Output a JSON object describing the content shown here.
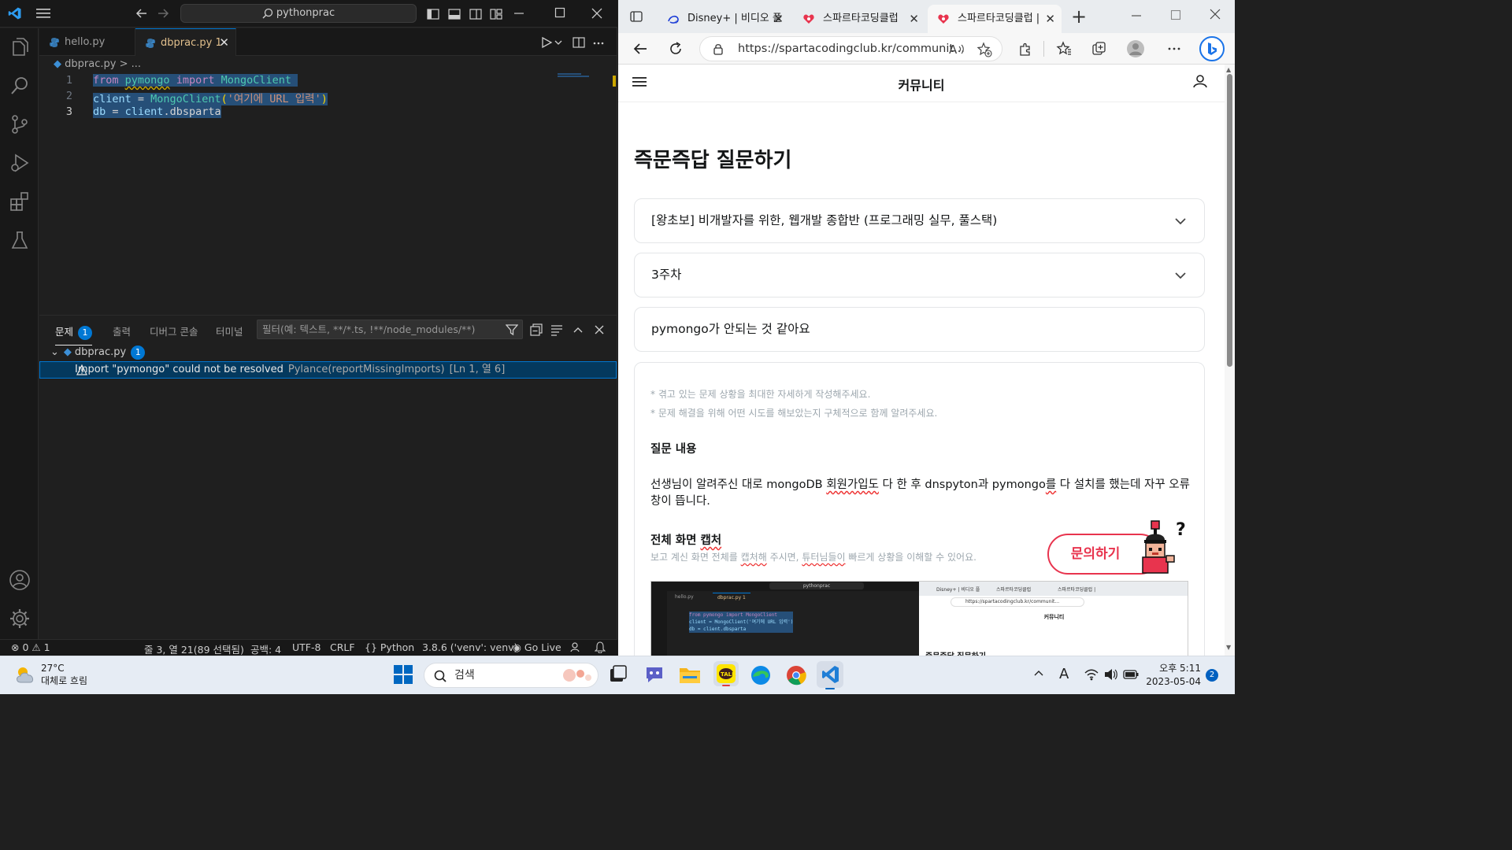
{
  "vscode": {
    "command_center": "pythonprac",
    "tabs": [
      {
        "label": "hello.py"
      },
      {
        "label": "dbprac.py",
        "badge": "1"
      }
    ],
    "breadcrumb": "dbprac.py > ...",
    "code": {
      "line_numbers": [
        "1",
        "2",
        "3"
      ],
      "line1": {
        "kw_from": "from",
        "module": "pymongo",
        "kw_import": "import",
        "class": "MongoClient"
      },
      "line2": {
        "var": "client",
        "eq": " = ",
        "func": "MongoClient",
        "open": "(",
        "string": "'여기에 URL 입력'",
        "close": ")"
      },
      "line3": {
        "var": "db",
        "eq": " = ",
        "obj": "client",
        "attr": ".dbsparta"
      }
    },
    "panel": {
      "tabs": [
        {
          "label": "문제",
          "badge": "1"
        },
        {
          "label": "출력"
        },
        {
          "label": "디버그 콘솔"
        },
        {
          "label": "터미널"
        }
      ],
      "filter_placeholder": "필터(예: 텍스트, **/*.ts, !**/node_modules/**)",
      "file": {
        "name": "dbprac.py",
        "badge": "1"
      },
      "problem": {
        "message": "Import \"pymongo\" could not be resolved",
        "source": "Pylance(reportMissingImports)",
        "location": "[Ln 1, 열 6]"
      }
    },
    "status": {
      "errors": "0",
      "warnings": "1",
      "cursor": "줄 3, 열 21(89 선택됨)",
      "indent": "공백: 4",
      "encoding": "UTF-8",
      "eol": "CRLF",
      "language": "Python",
      "interpreter": "3.8.6 ('venv': venv)",
      "golive": "Go Live"
    }
  },
  "browser": {
    "tabs": [
      {
        "label": "Disney+ | 비디오 플"
      },
      {
        "label": "스파르타코딩클럽"
      },
      {
        "label": "스파르타코딩클럽 |"
      }
    ],
    "url": "https://spartacodingclub.kr/communit...",
    "page": {
      "header_title": "커뮤니티",
      "heading": "즉문즉답 질문하기",
      "course_select": "[왕초보] 비개발자를 위한, 웹개발 종합반 (프로그래밍 실무, 풀스택)",
      "week_select": "3주차",
      "question_title": "pymongo가 안되는 것 같아요",
      "hints": [
        "* 겪고 있는 문제 상황을 최대한 자세하게 작성해주세요.",
        "* 문제 해결을 위해 어떤 시도를 해보았는지 구체적으로 함께 알려주세요."
      ],
      "content_label": "질문 내용",
      "content_text_a": "선생님이 알려주신 대로 mongoDB ",
      "content_text_b": "회원가입도",
      "content_text_c": " 다 한 후 dnspyton과 pymongo",
      "content_text_d": "를",
      "content_text_e": " 다 설치를 했는데 자꾸 오류 창이 뜹니다.",
      "capture_label_a": "전체 화면 ",
      "capture_label_b": "캡처",
      "capture_hint_a": "보고 계신 화면 전체를 ",
      "capture_hint_b": "캡처해",
      "capture_hint_c": " 주시면, ",
      "capture_hint_d": "튜터님들이",
      "capture_hint_e": " 빠르게 상황을 이해할 수 있어요.",
      "inquiry_button": "문의하기",
      "mini_capture": {
        "cmd": "pythonprac",
        "tab1": "hello.py",
        "tab2": "dbprac.py 1",
        "line1": "from pymongo import MongoClient",
        "line2": "client = MongoClient('여기에 URL 입력')",
        "line3": "db = client.dbsparta",
        "btab1": "Disney+ | 비디오 플",
        "btab2": "스파르타코딩클럽",
        "btab3": "스파르타코딩클럽 |",
        "url": "https://spartacodingclub.kr/communit...",
        "header": "커뮤니티",
        "heading": "즉문즉답 질문하기"
      }
    }
  },
  "taskbar": {
    "temperature": "27°C",
    "weather": "대체로 흐림",
    "search": "검색",
    "time": "오후 5:11",
    "date": "2023-05-04",
    "notifications": "2"
  },
  "colors": {
    "vscode_accent": "#0078d4",
    "warning": "#cca700",
    "brand_red": "#e8344e"
  }
}
